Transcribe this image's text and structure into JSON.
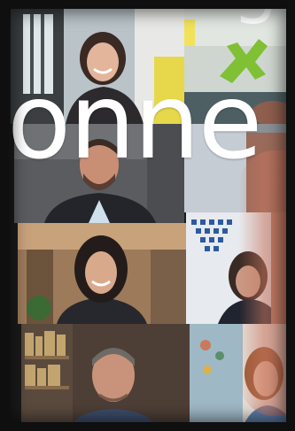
{
  "screen": {
    "brand_text": "onne",
    "brand_text_top": "g",
    "accent_colors": {
      "brand_white": "#ffffff",
      "logo_green": "#7fc035",
      "logo_yellow": "#f2e25a"
    }
  },
  "video_grid": {
    "tiles": [
      {
        "name": "participant-tile-woman-smiling-office",
        "icon": "person-video-icon"
      },
      {
        "name": "participant-tile-room-green-logo",
        "icon": "room-video-icon"
      },
      {
        "name": "participant-tile-man-beard",
        "icon": "person-video-icon"
      },
      {
        "name": "participant-tile-right-edge",
        "icon": "person-video-icon"
      },
      {
        "name": "participant-tile-woman-long-hair",
        "icon": "person-video-icon"
      },
      {
        "name": "participant-tile-woman-blue-pattern",
        "icon": "person-video-icon"
      },
      {
        "name": "participant-tile-man-gray-hair",
        "icon": "person-video-icon"
      },
      {
        "name": "participant-tile-woman-bottom-right",
        "icon": "person-video-icon"
      }
    ]
  }
}
